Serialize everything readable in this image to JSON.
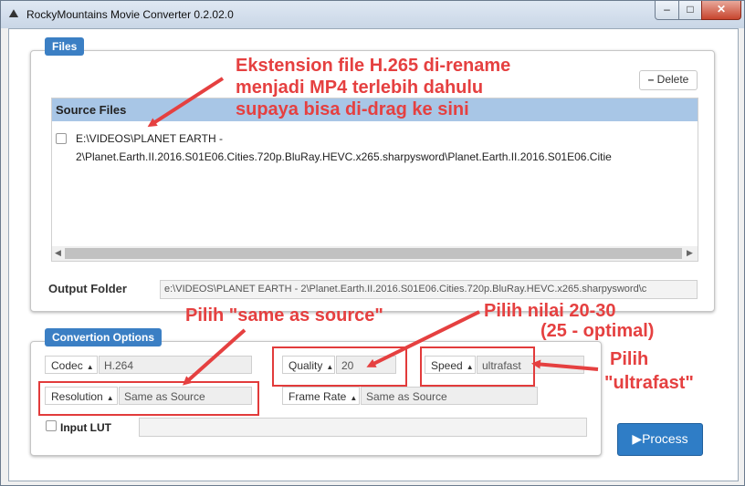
{
  "window": {
    "title": "RockyMountains Movie Converter 0.2.02.0",
    "min": "–",
    "max": "□",
    "close": "✕"
  },
  "files": {
    "badge": "Files",
    "delete_label": "Delete",
    "source_header": "Source Files",
    "source_line1": "E:\\VIDEOS\\PLANET EARTH -",
    "source_line2": "2\\Planet.Earth.II.2016.S01E06.Cities.720p.BluRay.HEVC.x265.sharpysword\\Planet.Earth.II.2016.S01E06.Citie",
    "output_label": "Output Folder",
    "output_value": "e:\\VIDEOS\\PLANET EARTH - 2\\Planet.Earth.II.2016.S01E06.Cities.720p.BluRay.HEVC.x265.sharpysword\\c"
  },
  "options": {
    "badge": "Convertion Options",
    "codec_label": "Codec",
    "codec_value": "H.264",
    "quality_label": "Quality",
    "quality_value": "20",
    "speed_label": "Speed",
    "speed_value": "ultrafast",
    "resolution_label": "Resolution",
    "resolution_value": "Same as Source",
    "framerate_label": "Frame Rate",
    "framerate_value": "Same as Source",
    "lut_label": "Input LUT",
    "lut_value": "",
    "process_label": "Process"
  },
  "annotations": {
    "drag_line1": "Ekstension file H.265 di-rename",
    "drag_line2": "menjadi MP4 terlebih dahulu",
    "drag_line3": "supaya bisa di-drag ke sini",
    "resolution_note": "Pilih \"same as source\"",
    "quality_note1": "Pilih nilai 20-30",
    "quality_note2": "(25 - optimal)",
    "speed_note1": "Pilih",
    "speed_note2": "\"ultrafast\""
  },
  "colors": {
    "accent": "#3b7fc4",
    "annotation": "#e54040",
    "header": "#a8c6e6"
  }
}
